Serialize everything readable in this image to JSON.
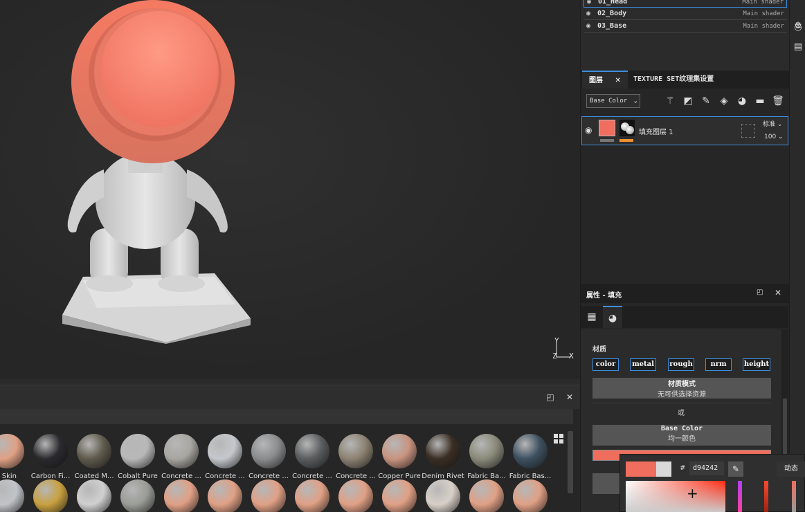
{
  "texture_sets": [
    {
      "name": "01_Head",
      "shader": "Main shader"
    },
    {
      "name": "02_Body",
      "shader": "Main shader"
    },
    {
      "name": "03_Base",
      "shader": "Main shader"
    }
  ],
  "layers_panel": {
    "tab_layers": "图层",
    "tab_settings": "TEXTURE SET纹理集设置",
    "channel_select": "Base Color",
    "layer": {
      "name": "填充图层 1",
      "blend_mode": "标准",
      "opacity": "100"
    }
  },
  "properties": {
    "title": "属性 - 填充",
    "material_label": "材质",
    "channels": [
      "color",
      "metal",
      "rough",
      "nrm",
      "height"
    ],
    "material_mode_title": "材质模式",
    "material_mode_sub": "无可供选择资源",
    "or_label": "或",
    "base_color_title": "Base Color",
    "base_color_sub": "均一颜色",
    "base_color_value": "#f06e5e"
  },
  "color_picker": {
    "hash": "#",
    "hex": "d94242",
    "mode": "动态"
  },
  "shelf": {
    "row1": [
      {
        "name": "f Skin",
        "color": "#e0a085"
      },
      {
        "name": "Carbon Fi...",
        "color": "#2a2a2e"
      },
      {
        "name": "Coated M...",
        "color": "#5f5a4c"
      },
      {
        "name": "Cobalt Pure",
        "color": "#b8b8b8"
      },
      {
        "name": "Concrete ...",
        "color": "#a8a6a0"
      },
      {
        "name": "Concrete ...",
        "color": "#c4c8cc"
      },
      {
        "name": "Concrete ...",
        "color": "#8a8c8e"
      },
      {
        "name": "Concrete ...",
        "color": "#5a5c5e"
      },
      {
        "name": "Concrete ...",
        "color": "#8c8272"
      },
      {
        "name": "Copper Pure",
        "color": "#c89480"
      },
      {
        "name": "Denim Rivet",
        "color": "#3a2e24"
      },
      {
        "name": "Fabric Ba...",
        "color": "#8a8a7a"
      },
      {
        "name": "Fabric Bas...",
        "color": "#3e5060"
      }
    ],
    "row2_colors": [
      "#c0c4c8",
      "#c8a040",
      "#d0d0d0",
      "#9a9c96",
      "#e0a085",
      "#e0a085",
      "#e0a085",
      "#e0a085",
      "#e0a085",
      "#e0a085",
      "#d8d0c8",
      "#e0a085",
      "#e0a085"
    ]
  },
  "gizmo": {
    "x": "X",
    "y": "Y",
    "z": "Z"
  },
  "colors": {
    "accent": "#3d8fe0",
    "head": "#f06e5e"
  }
}
